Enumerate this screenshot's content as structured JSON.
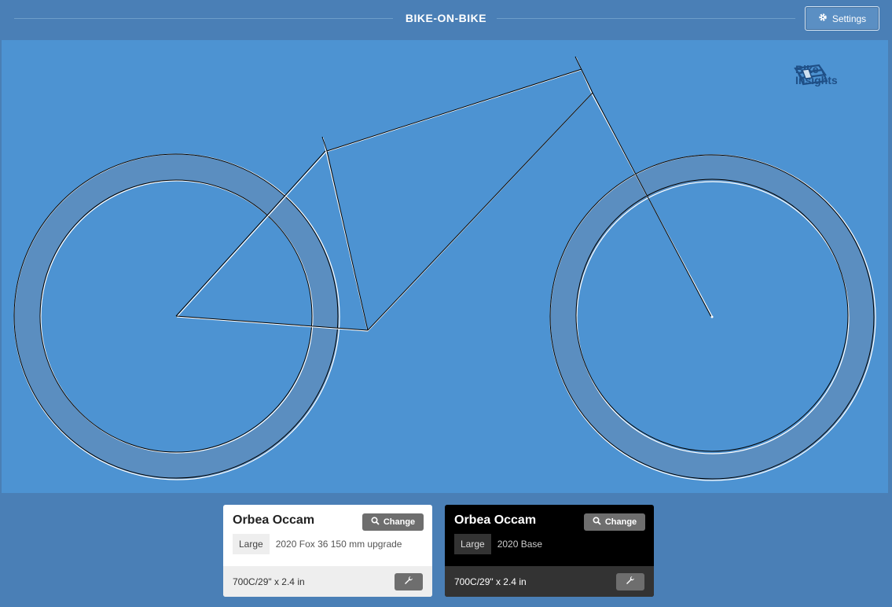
{
  "header": {
    "title": "BIKE-ON-BIKE",
    "settings_label": "Settings"
  },
  "logo": {
    "line1": "Bike",
    "line2": "Insights"
  },
  "colors": {
    "background": "#4a7fb5",
    "canvas": "#4d93d2",
    "tire": "#5b8ec0",
    "card_light": "#ffffff",
    "card_dark": "#000000",
    "button_gray": "#6e6e6e"
  },
  "bikes": [
    {
      "name": "Orbea Occam",
      "change_label": "Change",
      "size": "Large",
      "build": "2020 Fox 36 150 mm upgrade",
      "wheel": "700C/29\" x 2.4 in",
      "theme": "light"
    },
    {
      "name": "Orbea Occam",
      "change_label": "Change",
      "size": "Large",
      "build": "2020 Base",
      "wheel": "700C/29\" x 2.4 in",
      "theme": "dark"
    }
  ]
}
